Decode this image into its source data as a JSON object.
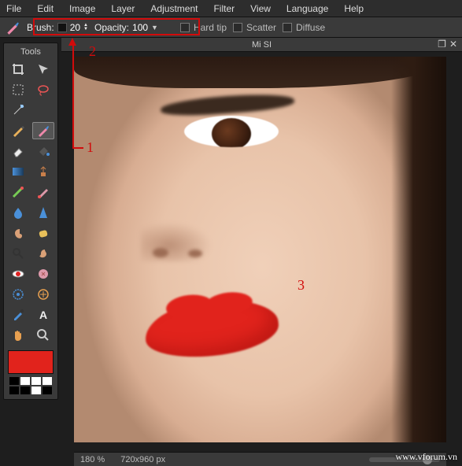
{
  "menu": {
    "file": "File",
    "edit": "Edit",
    "image": "Image",
    "layer": "Layer",
    "adjustment": "Adjustment",
    "filter": "Filter",
    "view": "View",
    "language": "Language",
    "help": "Help"
  },
  "options": {
    "brush_label": "Brush:",
    "brush_size": "20",
    "opacity_label": "Opacity:",
    "opacity_value": "100",
    "hardtip": "Hard tip",
    "scatter": "Scatter",
    "diffuse": "Diffuse"
  },
  "tools": {
    "title": "Tools",
    "foreground_color": "#e1231c"
  },
  "canvas": {
    "title": "Mi SI",
    "zoom": "180 %",
    "dimensions": "720x960 px"
  },
  "annotations": {
    "one": "1",
    "two": "2",
    "three": "3"
  },
  "watermark": "www.vforum.vn"
}
